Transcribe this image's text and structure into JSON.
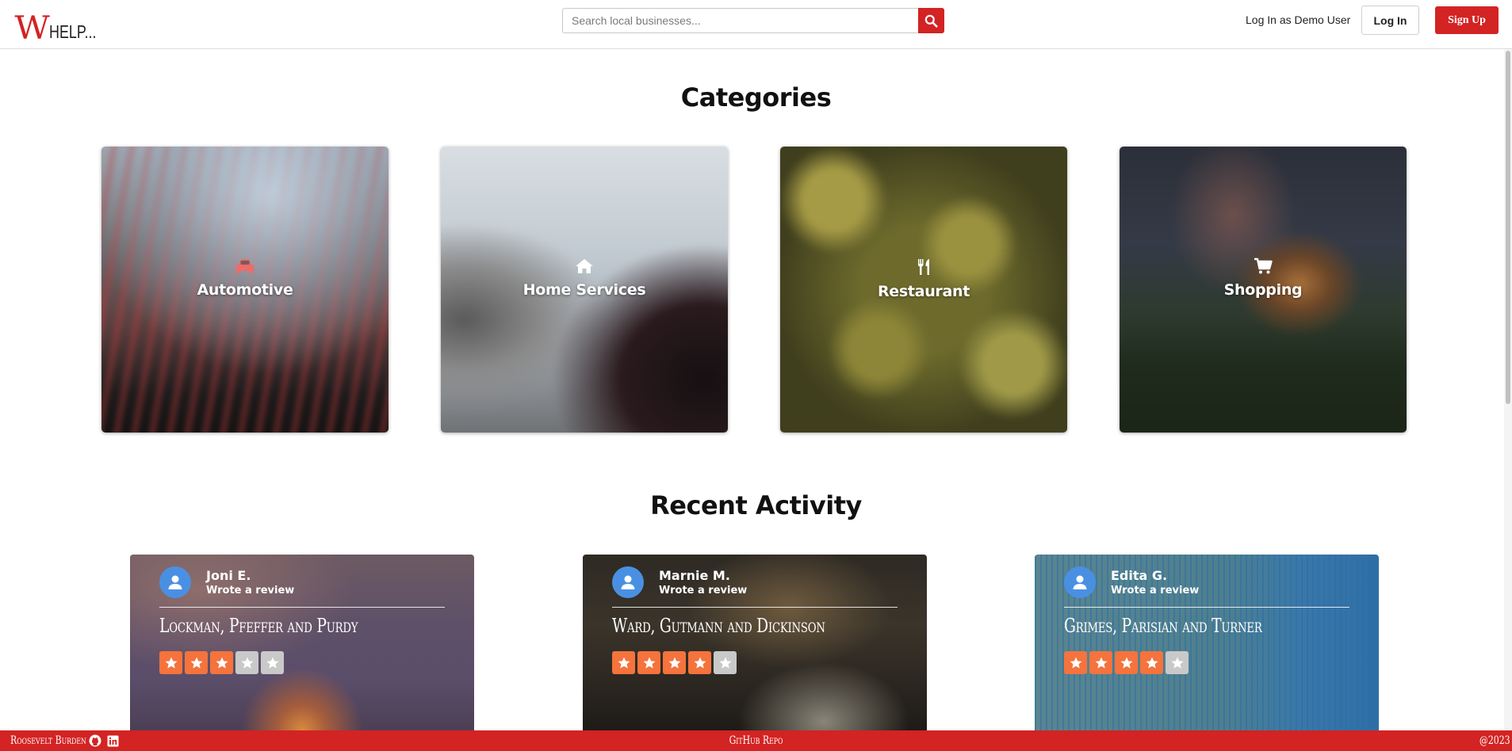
{
  "brand": {
    "logo_first": "W",
    "logo_rest": "HELP...",
    "accent": "#d32323"
  },
  "search": {
    "placeholder": "Search local businesses...",
    "icon": "search-icon"
  },
  "nav": {
    "demo_link": "Log In as Demo User",
    "login": "Log In",
    "signup": "Sign Up"
  },
  "categories": {
    "title": "Categories",
    "items": [
      {
        "label": "Automotive",
        "icon": "car-icon"
      },
      {
        "label": "Home Services",
        "icon": "home-icon"
      },
      {
        "label": "Restaurant",
        "icon": "utensils-icon"
      },
      {
        "label": "Shopping",
        "icon": "cart-icon"
      }
    ]
  },
  "activity": {
    "title": "Recent Activity",
    "items": [
      {
        "user": "Joni E.",
        "action": "Wrote a review",
        "business": "Lockman, Pfeffer and Purdy",
        "rating": 3,
        "max_rating": 5
      },
      {
        "user": "Marnie M.",
        "action": "Wrote a review",
        "business": "Ward, Gutmann and Dickinson",
        "rating": 4,
        "max_rating": 5
      },
      {
        "user": "Edita G.",
        "action": "Wrote a review",
        "business": "Grimes, Parisian and Turner",
        "rating": 4,
        "max_rating": 5
      }
    ]
  },
  "footer": {
    "author": "Roosevelt Burden",
    "repo_link": "GitHub Repo",
    "copyright": "@2023"
  }
}
